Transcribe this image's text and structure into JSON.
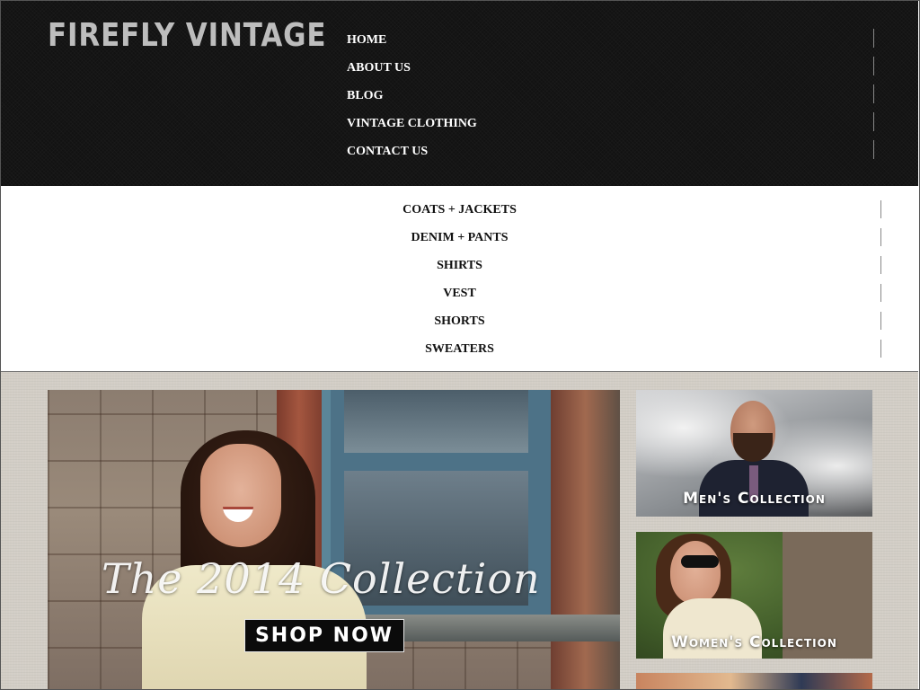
{
  "header": {
    "logo": "FIREFLY VINTAGE",
    "nav": [
      {
        "label": "HOME"
      },
      {
        "label": "ABOUT US"
      },
      {
        "label": "BLOG"
      },
      {
        "label": "VINTAGE CLOTHING"
      },
      {
        "label": "CONTACT US"
      }
    ]
  },
  "subnav": {
    "items": [
      {
        "label": "COATS + JACKETS"
      },
      {
        "label": "DENIM + PANTS"
      },
      {
        "label": "SHIRTS"
      },
      {
        "label": "VEST"
      },
      {
        "label": "SHORTS"
      },
      {
        "label": "SWEATERS"
      }
    ]
  },
  "hero": {
    "headline": "The 2014 Collection",
    "cta": "SHOP NOW"
  },
  "tiles": {
    "men": "Men's Collection",
    "women": "Women's Collection"
  },
  "colors": {
    "header_bg": "#121212",
    "content_bg": "#d3cec6",
    "nav_text": "#ffffff",
    "subnav_text": "#111111",
    "logo": "#bdbdbd"
  }
}
